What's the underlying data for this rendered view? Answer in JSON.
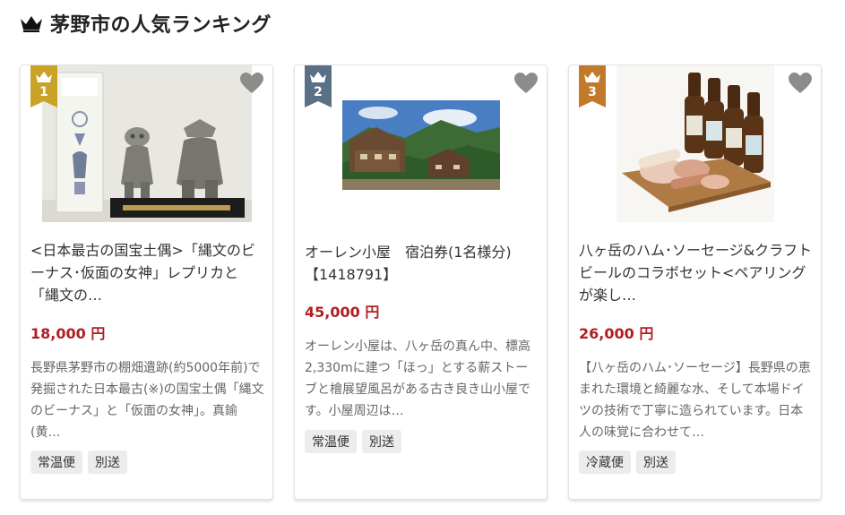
{
  "page": {
    "heading": "茅野市の人気ランキング",
    "accent_price_color": "#b01e23"
  },
  "items": [
    {
      "rank": "1",
      "rank_color": "#c9a227",
      "title": "<日本最古の国宝土偶>「縄文のビーナス･仮面の女神」レプリカと「縄文の…",
      "price": "18,000 円",
      "description": "長野県茅野市の棚畑遺跡(約5000年前)で発掘された日本最古(※)の国宝土偶「縄文のビーナス」と「仮面の女神」。真鍮(黄…",
      "tags": [
        "常温便",
        "別送"
      ],
      "image": "dogu-replica-photo",
      "favorite_icon": "heart-icon"
    },
    {
      "rank": "2",
      "rank_color": "#5a7087",
      "title": "オーレン小屋　宿泊券(1名様分)【1418791】",
      "price": "45,000 円",
      "description": "オーレン小屋は、八ヶ岳の真ん中、標高2,330mに建つ「ほっ」とする薪ストーブと檜展望風呂がある古き良き山小屋です。小屋周辺は…",
      "tags": [
        "常温便",
        "別送"
      ],
      "image": "mountain-hut-photo",
      "favorite_icon": "heart-icon"
    },
    {
      "rank": "3",
      "rank_color": "#c3792a",
      "title": "八ヶ岳のハム･ソーセージ&クラフトビールのコラボセット<ペアリングが楽し…",
      "price": "26,000 円",
      "description": "【八ヶ岳のハム･ソーセージ】長野県の恵まれた環境と綺麗な水、そして本場ドイツの技術で丁寧に造られています。日本人の味覚に合わせて…",
      "tags": [
        "冷蔵便",
        "別送"
      ],
      "image": "ham-beer-photo",
      "favorite_icon": "heart-icon"
    }
  ]
}
